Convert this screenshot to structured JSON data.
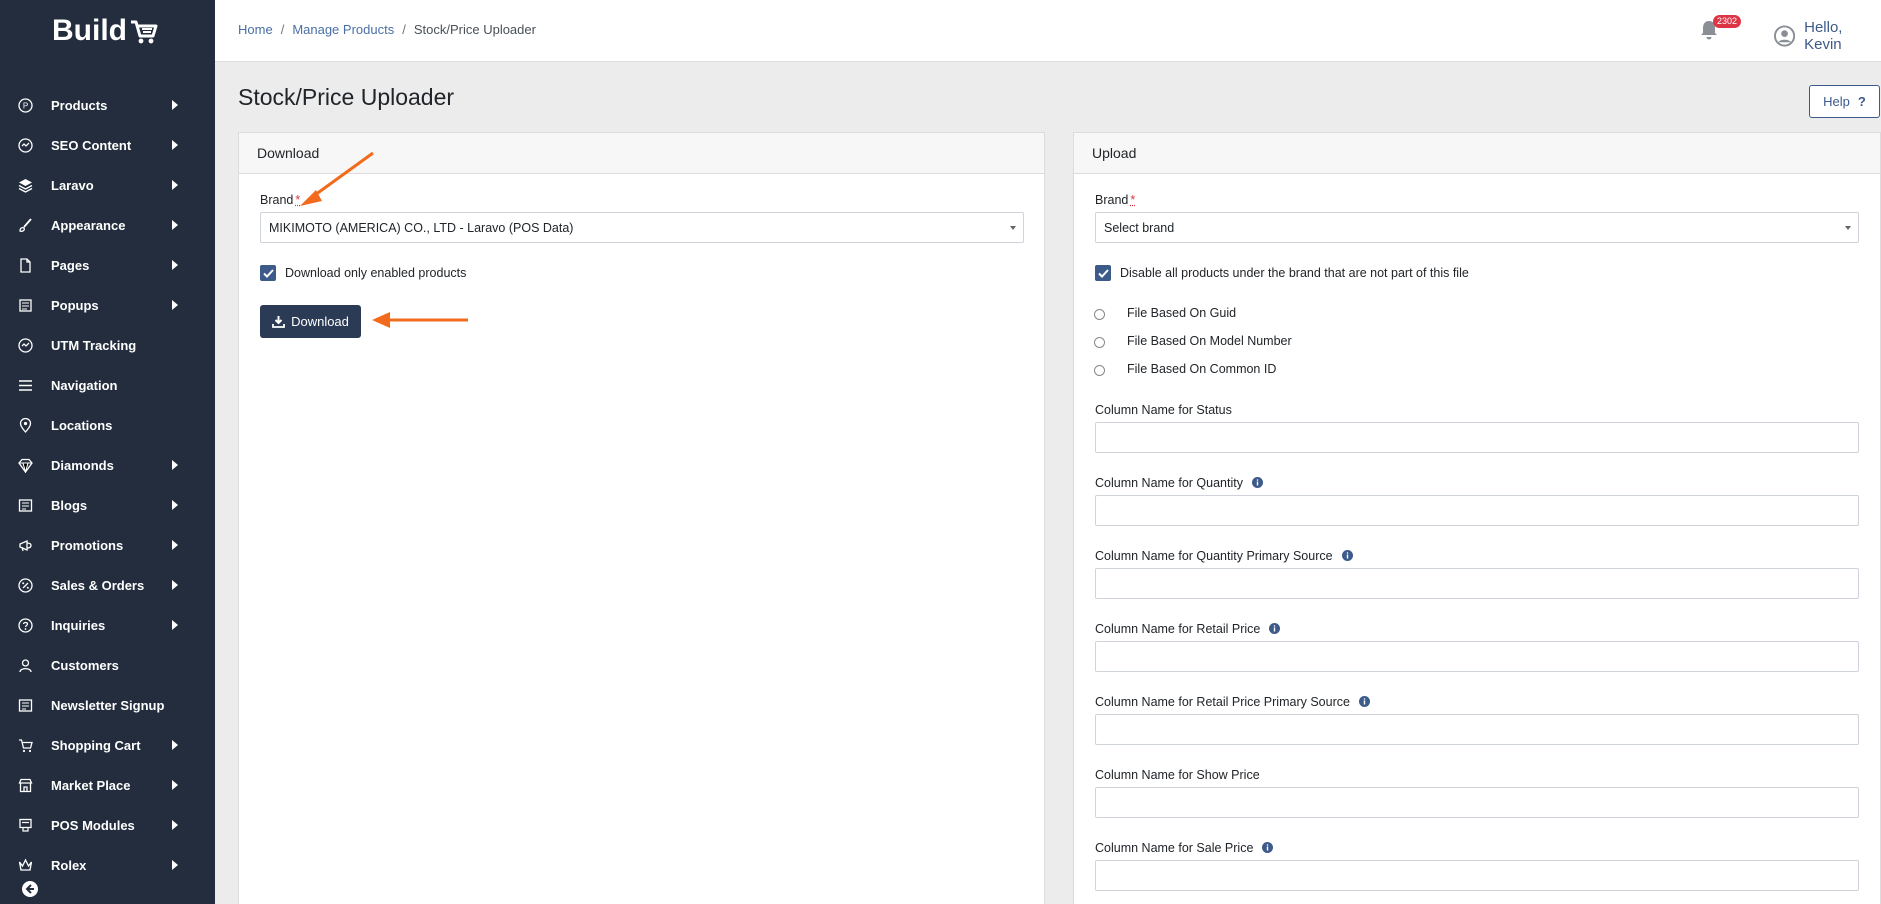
{
  "logo": {
    "text": "Build"
  },
  "sidebar": {
    "items": [
      {
        "label": "Products",
        "icon": "product-icon",
        "has_submenu": true
      },
      {
        "label": "SEO Content",
        "icon": "seo-icon",
        "has_submenu": true
      },
      {
        "label": "Laravo",
        "icon": "layers-icon",
        "has_submenu": true
      },
      {
        "label": "Appearance",
        "icon": "brush-icon",
        "has_submenu": true
      },
      {
        "label": "Pages",
        "icon": "page-icon",
        "has_submenu": true
      },
      {
        "label": "Popups",
        "icon": "popup-icon",
        "has_submenu": true
      },
      {
        "label": "UTM Tracking",
        "icon": "utm-icon",
        "has_submenu": false
      },
      {
        "label": "Navigation",
        "icon": "menu-icon",
        "has_submenu": false
      },
      {
        "label": "Locations",
        "icon": "location-pin-icon",
        "has_submenu": false
      },
      {
        "label": "Diamonds",
        "icon": "diamond-icon",
        "has_submenu": true
      },
      {
        "label": "Blogs",
        "icon": "blog-icon",
        "has_submenu": true
      },
      {
        "label": "Promotions",
        "icon": "megaphone-icon",
        "has_submenu": true
      },
      {
        "label": "Sales & Orders",
        "icon": "percent-icon",
        "has_submenu": true
      },
      {
        "label": "Inquiries",
        "icon": "question-icon",
        "has_submenu": true
      },
      {
        "label": "Customers",
        "icon": "user-icon",
        "has_submenu": false
      },
      {
        "label": "Newsletter Signup",
        "icon": "newsletter-icon",
        "has_submenu": false
      },
      {
        "label": "Shopping Cart",
        "icon": "cart-icon",
        "has_submenu": true
      },
      {
        "label": "Market Place",
        "icon": "store-icon",
        "has_submenu": true
      },
      {
        "label": "POS Modules",
        "icon": "pos-icon",
        "has_submenu": true
      },
      {
        "label": "Rolex",
        "icon": "crown-icon",
        "has_submenu": true
      }
    ]
  },
  "topbar": {
    "breadcrumb": [
      "Home",
      "Manage Products",
      "Stock/Price Uploader"
    ],
    "notification_count": "2302",
    "greeting": "Hello, Kevin"
  },
  "page": {
    "title": "Stock/Price Uploader",
    "help_label": "Help",
    "help_symbol": "?"
  },
  "download": {
    "header": "Download",
    "brand_label": "Brand",
    "required_mark": "*",
    "brand_value": "MIKIMOTO (AMERICA) CO., LTD - Laravo (POS Data)",
    "checkbox_label": "Download only enabled products",
    "checkbox_checked": true,
    "button_label": "Download"
  },
  "upload": {
    "header": "Upload",
    "brand_label": "Brand",
    "required_mark": "*",
    "brand_placeholder": "Select brand",
    "checkbox_label": "Disable all products under the brand that are not part of this file",
    "checkbox_checked": true,
    "radios": [
      "File Based On Guid",
      "File Based On Model Number",
      "File Based On Common ID"
    ],
    "fields": [
      {
        "label": "Column Name for Status",
        "info": false,
        "value": ""
      },
      {
        "label": "Column Name for Quantity",
        "info": true,
        "value": ""
      },
      {
        "label": "Column Name for Quantity Primary Source",
        "info": true,
        "value": ""
      },
      {
        "label": "Column Name for Retail Price",
        "info": true,
        "value": ""
      },
      {
        "label": "Column Name for Retail Price Primary Source",
        "info": true,
        "value": ""
      },
      {
        "label": "Column Name for Show Price",
        "info": false,
        "value": ""
      },
      {
        "label": "Column Name for Sale Price",
        "info": true,
        "value": ""
      }
    ]
  },
  "colors": {
    "sidebar_bg": "#232d3d",
    "primary": "#2b3a55",
    "link": "#4a6fa5",
    "annotation_arrow": "#f26b1d",
    "badge": "#dc3545"
  }
}
